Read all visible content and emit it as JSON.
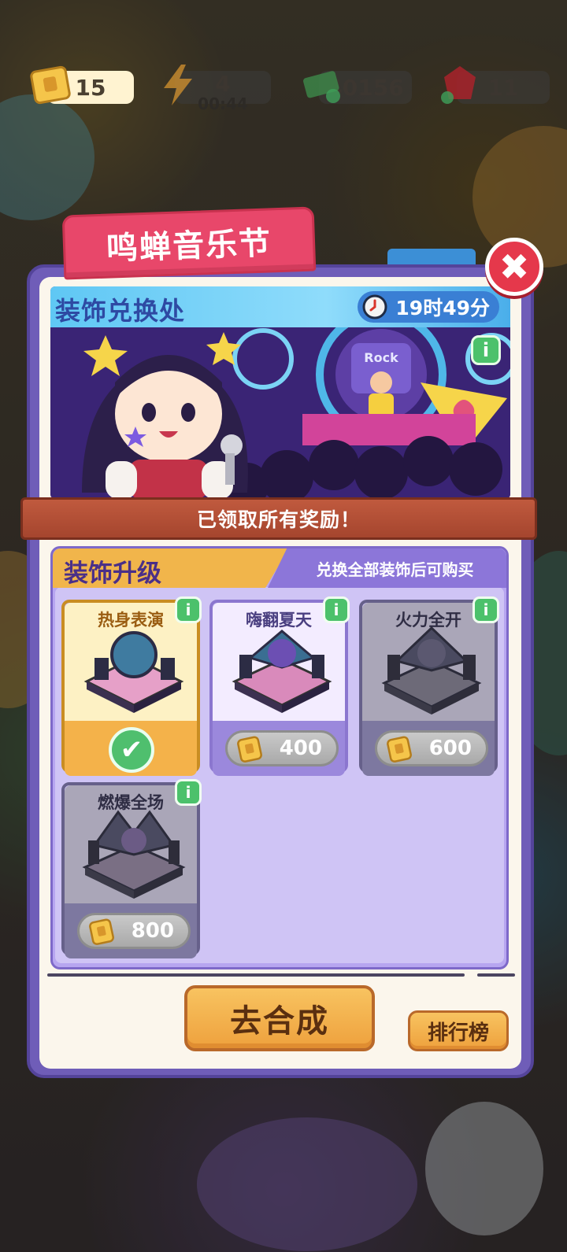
{
  "resources": {
    "tickets": "15",
    "energy": "4",
    "energy_timer": "00:44",
    "cash": "40156",
    "gems": "11"
  },
  "event": {
    "title": "鸣蝉音乐节",
    "banner_title": "装饰兑换处",
    "time_left": "19时49分",
    "ribbon": "已领取所有奖励！",
    "banner_sign": "Rock"
  },
  "upgrade": {
    "heading": "装饰升级",
    "notice": "兑换全部装饰后可购买",
    "info_label": "i",
    "items": [
      {
        "name": "热身表演",
        "state": "owned",
        "check": "✔"
      },
      {
        "name": "嗨翻夏天",
        "price": "400"
      },
      {
        "name": "火力全开",
        "price": "600"
      },
      {
        "name": "燃爆全场",
        "price": "800"
      }
    ]
  },
  "buttons": {
    "close": "✖",
    "go": "去合成",
    "ranking": "排行榜"
  },
  "colors": {
    "modal_frame": "#6f5db8",
    "title_tab": "#e8476a",
    "accent_orange": "#f4b24a",
    "info_green": "#4cc16b"
  }
}
